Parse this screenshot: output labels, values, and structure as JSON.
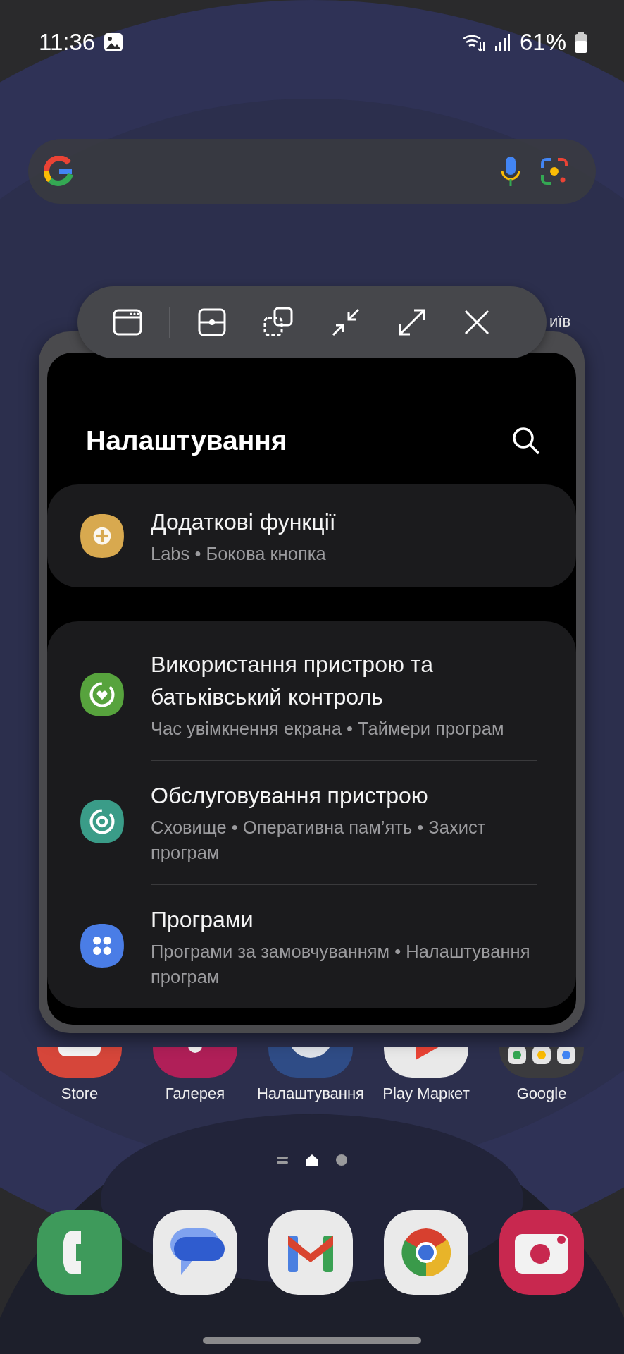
{
  "status_bar": {
    "time": "11:36",
    "battery": "61%"
  },
  "weather_widget": {
    "city": "иїв"
  },
  "settings_window": {
    "title": "Налаштування",
    "groups": [
      {
        "items": [
          {
            "kind": "labs",
            "color": "#d8a94f",
            "title": "Додаткові функції",
            "subtitle": "Labs  •  Бокова кнопка"
          }
        ]
      },
      {
        "items": [
          {
            "kind": "wellbeing",
            "color": "#57a33d",
            "title": "Використання пристрою та батьківський контроль",
            "subtitle": "Час увімкнення екрана  •  Таймери програм"
          },
          {
            "kind": "care",
            "color": "#3a9c88",
            "title": "Обслуговування пристрою",
            "subtitle": "Сховище  •  Оперативна пам’ять  •  Захист програм"
          },
          {
            "kind": "apps",
            "color": "#4a7de6",
            "title": "Програми",
            "subtitle": "Програми за замовчуванням  •  Налаштування програм"
          }
        ]
      }
    ]
  },
  "home_apps": [
    {
      "kind": "store",
      "label": "Store"
    },
    {
      "kind": "gallery",
      "label": "Галерея"
    },
    {
      "kind": "settings",
      "label": "Налаштування"
    },
    {
      "kind": "play",
      "label": "Play Маркет"
    },
    {
      "kind": "folder",
      "label": "Google"
    }
  ],
  "page_indicator": [
    {
      "kind": "list",
      "selected": false
    },
    {
      "kind": "home",
      "selected": true
    },
    {
      "kind": "dot",
      "selected": false
    }
  ],
  "dock": [
    {
      "kind": "phone"
    },
    {
      "kind": "messages"
    },
    {
      "kind": "mail"
    },
    {
      "kind": "browser"
    },
    {
      "kind": "camera"
    }
  ]
}
